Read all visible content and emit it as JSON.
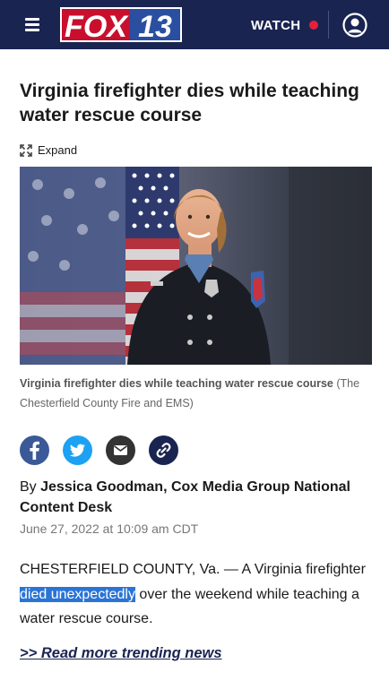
{
  "header": {
    "brand_fox": "FOX",
    "brand_number": "13",
    "watch_label": "WATCH",
    "colors": {
      "bar": "#1a2451",
      "logo_red": "#c8102e",
      "logo_blue": "#2a4fa0",
      "live_dot": "#e4203a"
    }
  },
  "article": {
    "headline": "Virginia firefighter dies while teaching water rescue course",
    "expand_label": "Expand",
    "caption_title": "Virginia firefighter dies while teaching water rescue course",
    "caption_credit": " (The Chesterfield County Fire and EMS)",
    "byline_prefix": "By ",
    "author": "Jessica Goodman, Cox Media Group National Content Desk",
    "date": "June 27, 2022 at 10:09 am CDT",
    "body_start": "CHESTERFIELD COUNTY, Va. — A Virginia firefighter ",
    "body_highlight": "died unexpectedly",
    "body_end": " over the weekend while teaching a water rescue course.",
    "read_more": ">> Read more trending news"
  },
  "share": {
    "icons": [
      "facebook-icon",
      "twitter-icon",
      "email-icon",
      "link-icon"
    ]
  }
}
